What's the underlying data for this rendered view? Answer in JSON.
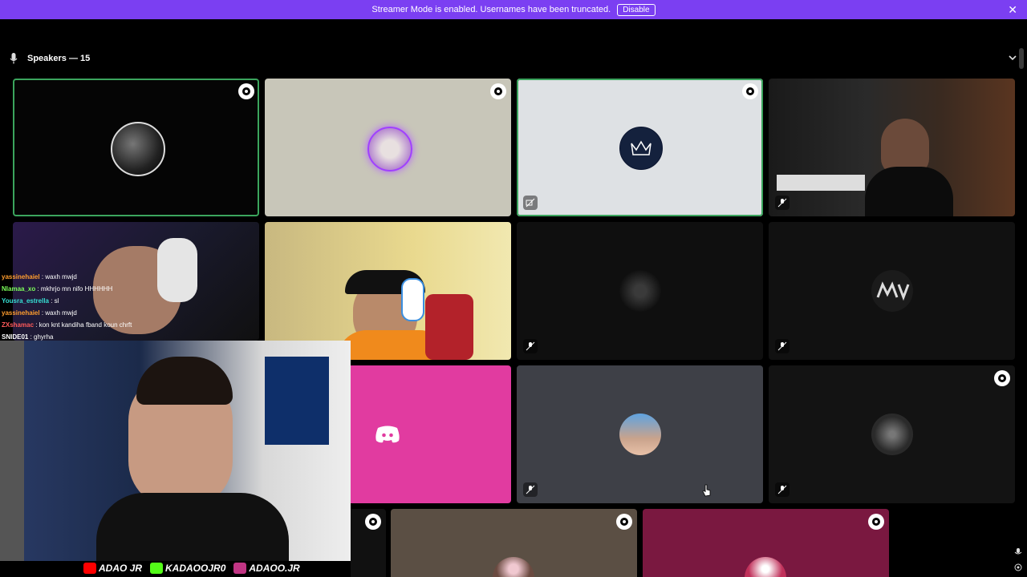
{
  "banner": {
    "message": "Streamer Mode is enabled. Usernames have been truncated.",
    "disable_label": "Disable",
    "close_icon": "close-icon"
  },
  "header": {
    "section_title": "Speakers — 15",
    "mic_icon": "microphone-icon",
    "collapse_icon": "chevron-down-icon"
  },
  "chat": [
    {
      "user": "yassinehaiel",
      "sep": " : ",
      "text": "waxh mwjd",
      "color": "#ff9d2e"
    },
    {
      "user": "Nlamaa_xo",
      "sep": " : ",
      "text": "mkhrjo mn nifo HHHHHH",
      "color": "#7dff5a"
    },
    {
      "user": "Yousra_estrella",
      "sep": " : ",
      "text": "sl",
      "color": "#36e0d4"
    },
    {
      "user": "yassinehaiel",
      "sep": " : ",
      "text": "waxh mwjd",
      "color": "#ff9d2e"
    },
    {
      "user": "ZXshamac",
      "sep": " : ",
      "text": "kon knt kandiha fband koun chrft",
      "color": "#ff5a5a"
    },
    {
      "user": "SNIDE01",
      "sep": " : ",
      "text": "ghyrha",
      "color": "#ffffff"
    }
  ],
  "socials": [
    {
      "icon": "youtube-icon",
      "handle": "ADAO JR",
      "color": "#ff0000"
    },
    {
      "icon": "kick-icon",
      "handle": "KADAOOJR0",
      "color": "#53fc18"
    },
    {
      "icon": "instagram-icon",
      "handle": "ADAOO.JR",
      "color": "#c13584"
    }
  ],
  "colors": {
    "banner": "#7b3ff2",
    "speaking_outline": "#3ba55d",
    "discord_pink": "#e13ba0"
  }
}
